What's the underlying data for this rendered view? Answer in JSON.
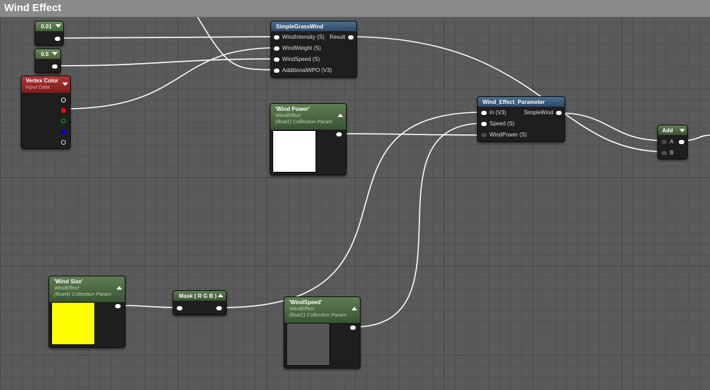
{
  "comment": {
    "title": "Wind Effect"
  },
  "constant_a": {
    "value": "0.01"
  },
  "constant_b": {
    "value": "0.5"
  },
  "vertex_color": {
    "title": "Vertex Color",
    "subtitle": "Input Data"
  },
  "simple_grass_wind": {
    "title": "SimpleGrassWind",
    "inputs": [
      "WindIntensity (S)",
      "WindWeight (S)",
      "WindSpeed (S)",
      "AdditionalWPO (V3)"
    ],
    "output": "Result"
  },
  "wind_power": {
    "title": "'Wind Power'",
    "subtitle1": "WindEffect",
    "subtitle2": "(float1) Collection Param",
    "preview_color": "#ffffff"
  },
  "wind_effect_parameter": {
    "title": "Wind_Effect_Parameter",
    "inputs": [
      "In (V3)",
      "Speed (S)",
      "WindPower (S)"
    ],
    "output": "SimpleWind"
  },
  "add": {
    "title": "Add",
    "inputs": [
      "A",
      "B"
    ]
  },
  "wind_size": {
    "title": "'Wind Size'",
    "subtitle1": "WindEffect",
    "subtitle2": "(float4) Collection Param",
    "preview_color": "#ffff00"
  },
  "mask": {
    "title": "Mask ( R G B )"
  },
  "wind_speed": {
    "title": "'WindSpeed'",
    "subtitle1": "WindEffect",
    "subtitle2": "(float1) Collection Param",
    "preview_color": "#555555"
  },
  "colors": {
    "graph_bg": "#5a5a5a",
    "wire": "#ffffff",
    "function_header": "#3c5a78",
    "parameter_header": "#4e6b44",
    "input_header": "#9a2a2a",
    "pin_red": "#ff0000",
    "pin_green": "#00cc00",
    "pin_blue": "#0000cc"
  }
}
